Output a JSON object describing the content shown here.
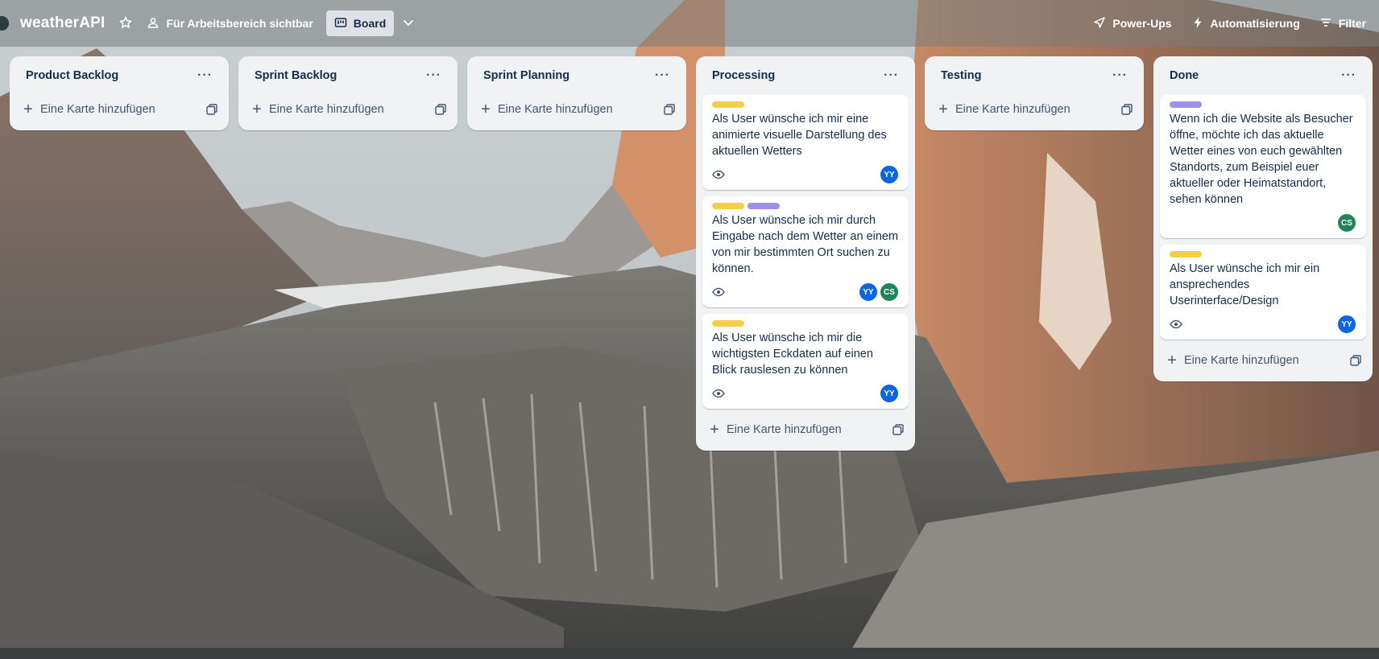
{
  "header": {
    "board_name": "weatherAPI",
    "visibility_label": "Für Arbeitsbereich sichtbar",
    "view_label": "Board",
    "powerups_label": "Power-Ups",
    "automation_label": "Automatisierung",
    "filter_label": "Filter"
  },
  "add_card_label": "Eine Karte hinzufügen",
  "colors": {
    "label_yellow": "#f5cd47",
    "label_purple": "#9f8fef",
    "avatar_yy": "#0c66e4",
    "avatar_cs": "#1f845a"
  },
  "lists": [
    {
      "title": "Product Backlog",
      "cards": []
    },
    {
      "title": "Sprint Backlog",
      "cards": []
    },
    {
      "title": "Sprint Planning",
      "cards": []
    },
    {
      "title": "Processing",
      "cards": [
        {
          "labels": [
            "yellow"
          ],
          "text": "Als User wünsche ich mir eine animierte visuelle Darstellung des aktuellen Wetters",
          "members": [
            "YY"
          ]
        },
        {
          "labels": [
            "yellow",
            "purple"
          ],
          "text": "Als User wünsche ich mir durch Eingabe nach dem Wetter an einem von mir bestimmten Ort suchen zu können.",
          "members": [
            "YY",
            "CS"
          ]
        },
        {
          "labels": [
            "yellow"
          ],
          "text": "Als User wünsche ich mir die wichtigsten Eckdaten auf einen Blick rauslesen zu können",
          "members": [
            "YY"
          ]
        }
      ]
    },
    {
      "title": "Testing",
      "cards": []
    },
    {
      "title": "Done",
      "cards": [
        {
          "labels": [
            "purple"
          ],
          "text": "Wenn ich die Website als Besucher öffne, möchte ich das aktuelle Wetter eines von euch gewählten Standorts, zum Beispiel euer aktueller oder Heimatstandort, sehen können",
          "members": [
            "CS"
          ]
        },
        {
          "labels": [
            "yellow"
          ],
          "text": "Als User wünsche ich mir ein ansprechendes Userinterface/Design",
          "members": [
            "YY"
          ]
        }
      ]
    }
  ]
}
